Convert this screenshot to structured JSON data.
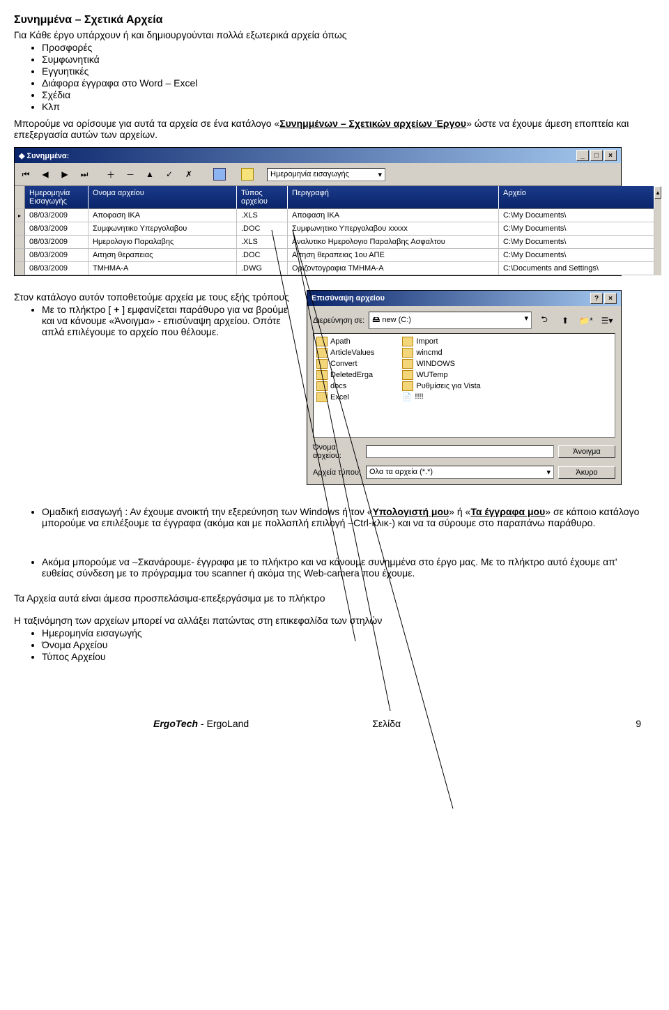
{
  "heading": "Συνημμένα – Σχετικά Αρχεία",
  "intro": "Για Κάθε έργο υπάρχουν ή και δημιουργούνται πολλά εξωτερικά αρχεία όπως",
  "bullets_top": [
    "Προσφορές",
    "Συμφωνητικά",
    "Εγγυητικές",
    "Διάφορα έγγραφα στο Word – Excel",
    "Σχέδια",
    "Κλπ"
  ],
  "para1_a": "Μπορούμε να ορίσουμε για  αυτά τα αρχεία σε ένα κατάλογο «",
  "para1_u": "Συνημμένων – Σχετικών αρχείων  Έργου",
  "para1_b": "» ώστε να έχουμε άμεση εποπτεία και επεξεργασία αυτών των αρχείων.",
  "window1": {
    "title": "Συνημμένα:",
    "sort_field": "Ημερομηνία εισαγωγής",
    "columns": [
      "Ημερομηνία Εισαγωγής",
      "Ονομα αρχείου",
      "Τύπος αρχείου",
      "Περιγραφή",
      "Αρχείο"
    ],
    "rows": [
      {
        "date": "08/03/2009",
        "name": "Αποφαση  ΙΚΑ",
        "type": ".XLS",
        "desc": "Αποφαση  ΙΚΑ",
        "file": "C:\\My Documents\\"
      },
      {
        "date": "08/03/2009",
        "name": "Συμφωνητικο Υπεργολαβου",
        "type": ".DOC",
        "desc": "Συμφωνητικο Υπεργολαβου xxxxx",
        "file": "C:\\My Documents\\"
      },
      {
        "date": "08/03/2009",
        "name": "Ημερολογιο Παραλαβης",
        "type": ".XLS",
        "desc": "Αναλυτικο Ημερολογιο Παραλαβης Ασφαλτου",
        "file": "C:\\My Documents\\"
      },
      {
        "date": "08/03/2009",
        "name": "Αιτηση θεραπειας",
        "type": ".DOC",
        "desc": "Αιτηση θεραπειας 1ου ΑΠΕ",
        "file": "C:\\My Documents\\"
      },
      {
        "date": "08/03/2009",
        "name": "ΤΜΗΜΑ-Α",
        "type": ".DWG",
        "desc": "Οριζοντογραφια  ΤΜΗΜΑ-Α",
        "file": "C:\\Documents and Settings\\"
      }
    ]
  },
  "para2": "Στον κατάλογο αυτόν τοποθετούμε αρχεία με τους εξής τρόπους",
  "bullet_plus_a": "Με το πλήκτρο [ ",
  "bullet_plus_sym": "+",
  "bullet_plus_b": " ] εμφανίζεται παράθυρο για να βρούμε και να κάνουμε «Άνοιγμα» - επισύναψη αρχείου. Οπότε απλά επιλέγουμε το αρχείο που θέλουμε.",
  "filedialog": {
    "title": "Επισύναψη αρχείου",
    "lookin_label": "Διερεύνηση σε:",
    "lookin_value": "new (C:)",
    "folders_left": [
      "Apath",
      "ArticleValues",
      "Convert",
      "DeletedErga",
      "docs",
      "Excel"
    ],
    "folders_right": [
      "Import",
      "wincmd",
      "WINDOWS",
      "WUTemp",
      "Ρυθμίσεις για Vista",
      "!!!!"
    ],
    "name_label": "Όνομα αρχείου:",
    "type_label": "Αρχεία τύπου:",
    "type_value": "Ολα τα αρχεία (*.*)",
    "open_btn": "Άνοιγμα",
    "cancel_btn": "Άκυρο"
  },
  "bullet_group_a": "Ομαδική εισαγωγή  : Αν έχουμε ανοικτή την εξερεύνηση των Windows ή τον «",
  "bullet_group_u1": "Υπολογιστή μου",
  "bullet_group_mid": "»  ή «",
  "bullet_group_u2": "Τα έγγραφα μου",
  "bullet_group_b": "» σε κάποιο κατάλογο μπορούμε να επιλέξουμε τα έγγραφα (ακόμα και με πολλαπλή επιλογή –Ctrl-κλικ-) και να τα σύρουμε στο παραπάνω παράθυρο.",
  "bullet_scan": "Ακόμα μπορούμε να –Σκανάρουμε- έγγραφα με το πλήκτρο και να κάνουμε συνημμένα στο έργο μας.  Με το πλήκτρο αυτό έχουμε απ' ευθείας σύνδεση με το πρόγραμμα του scanner ή ακόμα της Web-camera που έχουμε.",
  "para3": "Τα Αρχεία αυτά είναι άμεσα προσπελάσιμα-επεξεργάσιμα με το πλήκτρο",
  "para4": "Η ταξινόμηση των αρχείων μπορεί να αλλάξει πατώντας στη επικεφαλίδα των στηλών",
  "bullets_bot": [
    "Ημερομηνία εισαγωγής",
    "Όνομα Αρχείου",
    "Τύπος Αρχείου"
  ],
  "footer": {
    "brand_b": "ErgoTech",
    "brand_rest": " - ErgoLand",
    "center": "Σελίδα",
    "page": "9"
  }
}
